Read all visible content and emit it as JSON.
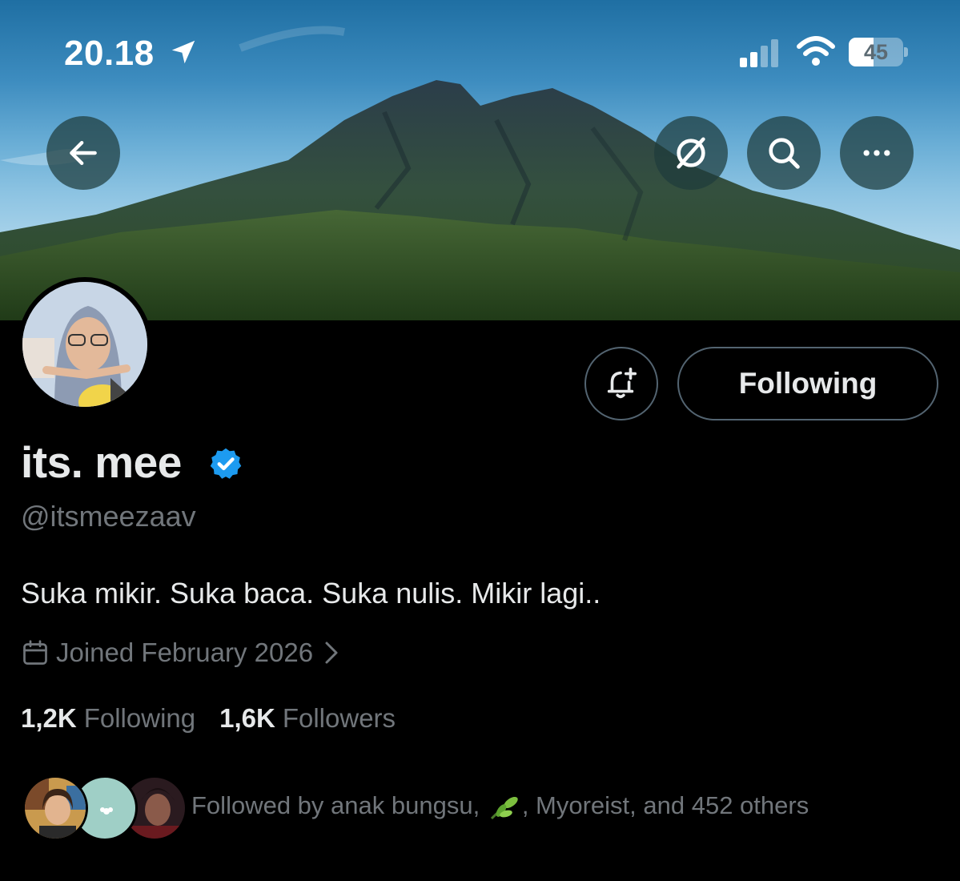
{
  "status_bar": {
    "time": "20.18",
    "battery_level": "45",
    "battery_fraction": 0.45,
    "location_icon": "location-arrow-icon",
    "signal_icon": "cellular-signal-icon",
    "wifi_icon": "wifi-icon"
  },
  "header": {
    "back_icon": "back-arrow-icon",
    "grok_icon": "grok-icon",
    "search_icon": "search-icon",
    "more_icon": "more-icon"
  },
  "profile": {
    "display_name": "its. mee",
    "verified": true,
    "handle": "@itsmeezaav",
    "bio": "Suka mikir. Suka baca. Suka nulis. Mikir lagi..",
    "joined": "Joined February 2026",
    "following_count": "1,2K",
    "following_label": "Following",
    "followers_count": "1,6K",
    "followers_label": "Followers"
  },
  "actions": {
    "notify_icon": "bell-plus-icon",
    "follow_button_label": "Following"
  },
  "followed_by": {
    "prefix": "Followed by anak bungsu,",
    "suffix": ", Myoreist, and 452 others"
  },
  "colors": {
    "background": "#000000",
    "primary_text": "#e7e9ea",
    "secondary_text": "#71767b",
    "border": "#536471",
    "verified_blue": "#1d9bf0"
  }
}
